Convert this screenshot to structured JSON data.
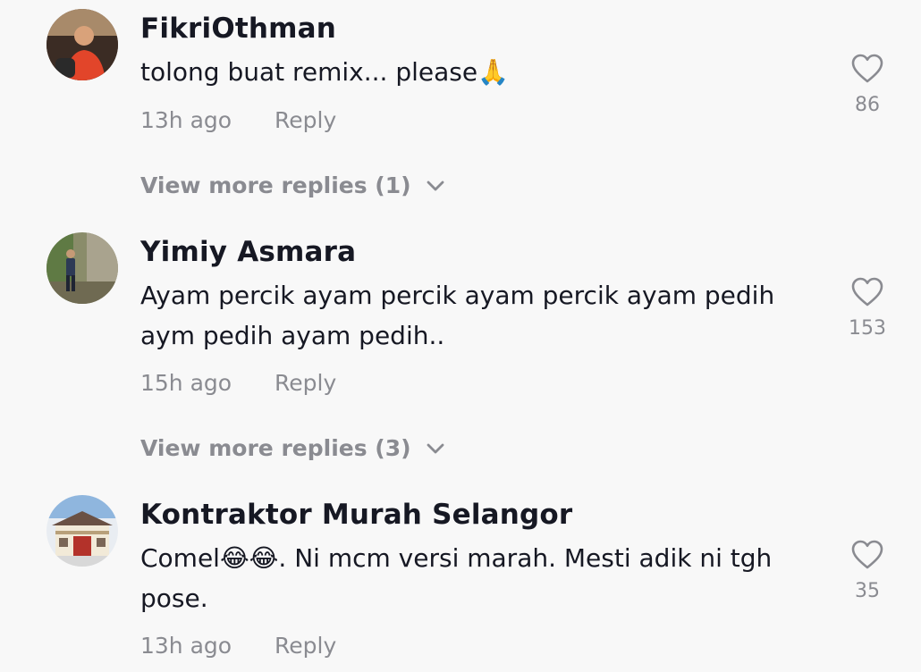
{
  "comments": [
    {
      "username": "FikriOthman",
      "text": "tolong buat remix... please🙏",
      "time": "13h ago",
      "reply": "Reply",
      "likes": "86",
      "more_replies": "View more replies (1)"
    },
    {
      "username": "Yimiy Asmara",
      "text": "Ayam percik ayam percik ayam percik ayam pedih aym pedih ayam pedih..",
      "time": "15h ago",
      "reply": "Reply",
      "likes": "153",
      "more_replies": "View more replies (3)"
    },
    {
      "username": "Kontraktor Murah Selangor",
      "text": "Comel😂😂. Ni mcm versi marah. Mesti adik ni tgh pose.",
      "time": "13h ago",
      "reply": "Reply",
      "likes": "35"
    }
  ],
  "icons": {
    "like": "heart-outline-icon",
    "expand": "chevron-down-icon"
  },
  "colors": {
    "background": "#f8f8f8",
    "text": "#161823",
    "secondary": "#8a8b91"
  }
}
